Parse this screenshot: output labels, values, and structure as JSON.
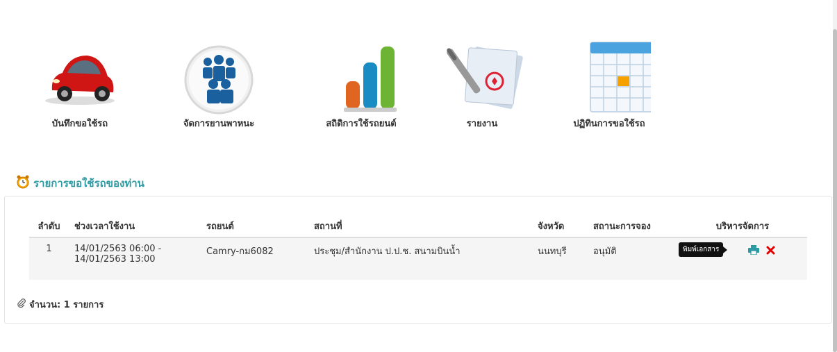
{
  "menu": [
    {
      "label": "บันทึกขอใช้รถ",
      "icon": "car-icon"
    },
    {
      "label": "จัดการยานพาหนะ",
      "icon": "users-icon"
    },
    {
      "label": "สถิติการใช้รถยนต์",
      "icon": "bar-chart-icon"
    },
    {
      "label": "รายงาน",
      "icon": "document-icon"
    },
    {
      "label": "ปฏิทินการขอใช้รถ",
      "icon": "calendar-icon"
    }
  ],
  "section": {
    "title": "รายการขอใช้รถของท่าน",
    "icon": "alarm-clock-icon"
  },
  "table": {
    "headers": [
      "ลำดับ",
      "ช่วงเวลาใช้งาน",
      "รถยนต์",
      "สถานที่",
      "จังหวัด",
      "สถานะการจอง",
      "บริหารจัดการ"
    ],
    "rows": [
      {
        "no": "1",
        "time_start": "14/01/2563 06:00 -",
        "time_end": "14/01/2563 13:00",
        "car": "Camry-กม6082",
        "place": "ประชุม/สำนักงาน ป.ป.ช. สนามบินน้ำ",
        "province": "นนทบุรี",
        "status": "อนุมัติ"
      }
    ]
  },
  "tooltip": "พิมพ์เอกสาร",
  "count_label": "จำนวน: 1 รายการ",
  "colors": {
    "accent": "#2b9aa3",
    "print": "#2b9aa3",
    "delete": "#e00000"
  }
}
